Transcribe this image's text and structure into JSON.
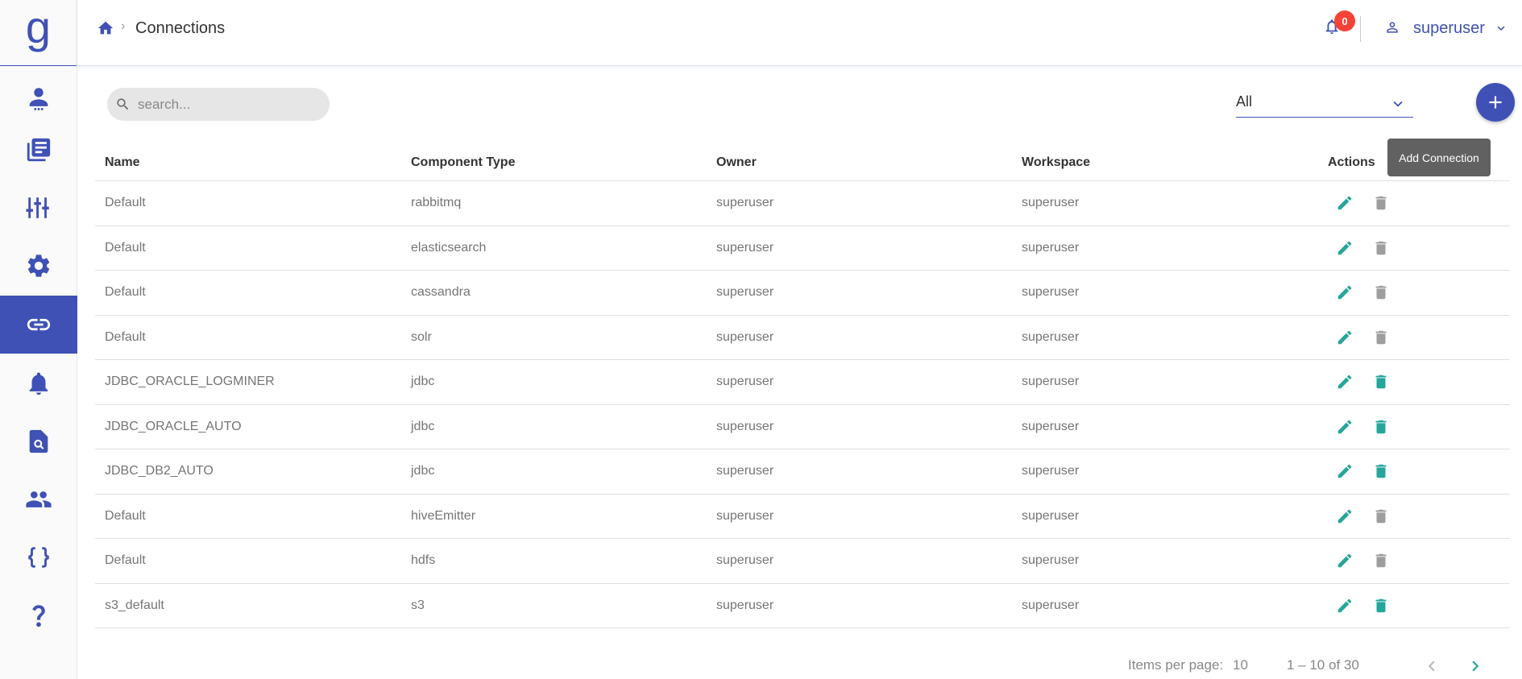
{
  "app": {
    "logo": "g",
    "accent_color": "#3f51b5"
  },
  "sidebar": {
    "items": [
      {
        "name": "users-icon",
        "active": false
      },
      {
        "name": "library-icon",
        "active": false
      },
      {
        "name": "tune-icon",
        "active": false
      },
      {
        "name": "settings-icon",
        "active": false
      },
      {
        "name": "link-icon",
        "active": true
      },
      {
        "name": "bell-icon",
        "active": false
      },
      {
        "name": "search-doc-icon",
        "active": false
      },
      {
        "name": "people-icon",
        "active": false
      },
      {
        "name": "braces-icon",
        "active": false
      },
      {
        "name": "help-icon",
        "active": false
      }
    ]
  },
  "header": {
    "breadcrumb_title": "Connections",
    "notification_count": "0",
    "user_name": "superuser"
  },
  "toolbar": {
    "search_placeholder": "search...",
    "filter_value": "All",
    "add_tooltip": "Add Connection"
  },
  "table": {
    "columns": [
      "Name",
      "Component Type",
      "Owner",
      "Workspace",
      "Actions"
    ],
    "rows": [
      {
        "name": "Default",
        "type": "rabbitmq",
        "owner": "superuser",
        "workspace": "superuser",
        "delete_enabled": false
      },
      {
        "name": "Default",
        "type": "elasticsearch",
        "owner": "superuser",
        "workspace": "superuser",
        "delete_enabled": false
      },
      {
        "name": "Default",
        "type": "cassandra",
        "owner": "superuser",
        "workspace": "superuser",
        "delete_enabled": false
      },
      {
        "name": "Default",
        "type": "solr",
        "owner": "superuser",
        "workspace": "superuser",
        "delete_enabled": false
      },
      {
        "name": "JDBC_ORACLE_LOGMINER",
        "type": "jdbc",
        "owner": "superuser",
        "workspace": "superuser",
        "delete_enabled": true
      },
      {
        "name": "JDBC_ORACLE_AUTO",
        "type": "jdbc",
        "owner": "superuser",
        "workspace": "superuser",
        "delete_enabled": true
      },
      {
        "name": "JDBC_DB2_AUTO",
        "type": "jdbc",
        "owner": "superuser",
        "workspace": "superuser",
        "delete_enabled": true
      },
      {
        "name": "Default",
        "type": "hiveEmitter",
        "owner": "superuser",
        "workspace": "superuser",
        "delete_enabled": false
      },
      {
        "name": "Default",
        "type": "hdfs",
        "owner": "superuser",
        "workspace": "superuser",
        "delete_enabled": false
      },
      {
        "name": "s3_default",
        "type": "s3",
        "owner": "superuser",
        "workspace": "superuser",
        "delete_enabled": true
      }
    ]
  },
  "pagination": {
    "items_per_page_label": "Items per page:",
    "items_per_page": "10",
    "range_label": "1 – 10 of 30"
  },
  "colors": {
    "edit": "#26a69a",
    "delete_enabled": "#26a69a",
    "delete_disabled": "#9e9e9e"
  }
}
